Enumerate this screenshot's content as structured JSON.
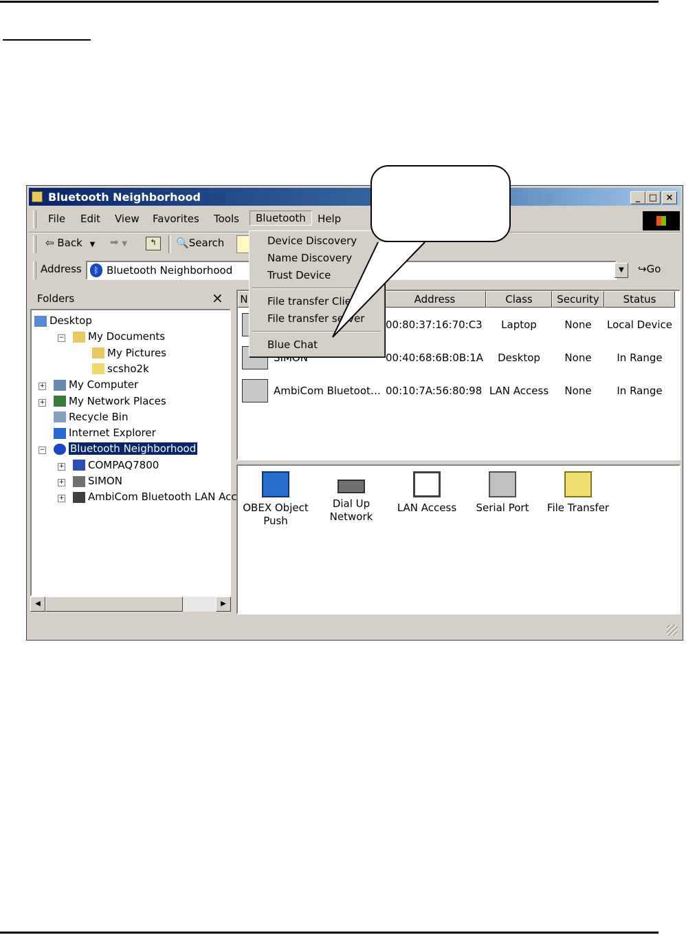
{
  "window": {
    "title": "Bluetooth Neighborhood"
  },
  "menubar": {
    "items": [
      "File",
      "Edit",
      "View",
      "Favorites",
      "Tools",
      "Bluetooth",
      "Help"
    ]
  },
  "toolbar": {
    "back_label": "Back",
    "search_label": "Search"
  },
  "address_bar": {
    "label": "Address",
    "value": "Bluetooth Neighborhood",
    "go_label": "Go"
  },
  "bluetooth_menu": {
    "items": [
      "Device Discovery",
      "Name Discovery",
      "Trust Device",
      "File transfer Client",
      "File transfer server",
      "Blue Chat"
    ]
  },
  "folders": {
    "title": "Folders",
    "close_glyph": "×",
    "tree": [
      {
        "label": "Desktop",
        "icon": "desktop-icon"
      },
      {
        "label": "My Documents",
        "icon": "my-documents-icon",
        "expander": "−"
      },
      {
        "label": "My Pictures",
        "icon": "my-pictures-icon"
      },
      {
        "label": "scsho2k",
        "icon": "folder-icon"
      },
      {
        "label": "My Computer",
        "icon": "my-computer-icon",
        "expander": "+"
      },
      {
        "label": "My Network Places",
        "icon": "network-places-icon",
        "expander": "+"
      },
      {
        "label": "Recycle Bin",
        "icon": "recycle-bin-icon"
      },
      {
        "label": "Internet Explorer",
        "icon": "internet-explorer-icon"
      },
      {
        "label": "Bluetooth Neighborhood",
        "icon": "bluetooth-icon",
        "expander": "−",
        "selected": true
      },
      {
        "label": "COMPAQ7800",
        "icon": "laptop-icon",
        "expander": "+"
      },
      {
        "label": "SIMON",
        "icon": "desktop-computer-icon",
        "expander": "+"
      },
      {
        "label": "AmbiCom Bluetooth LAN Acce",
        "icon": "lan-access-icon",
        "expander": "+"
      }
    ]
  },
  "device_list": {
    "columns": [
      "N",
      "Address",
      "Class",
      "Security",
      "Status"
    ],
    "rows": [
      {
        "name": "",
        "address": "00:80:37:16:70:C3",
        "class": "Laptop",
        "security": "None",
        "status": "Local Device",
        "icon": "laptop-icon"
      },
      {
        "name": "SIMON",
        "address": "00:40:68:6B:0B:1A",
        "class": "Desktop",
        "security": "None",
        "status": "In Range",
        "icon": "desktop-computer-icon"
      },
      {
        "name": "AmbiCom Bluetoot…",
        "address": "00:10:7A:56:80:98",
        "class": "LAN Access",
        "security": "None",
        "status": "In Range",
        "icon": "lan-access-icon"
      }
    ]
  },
  "services": [
    {
      "label": "OBEX Object Push",
      "icon": "obex-push-icon"
    },
    {
      "label": "Dial Up Network",
      "icon": "modem-icon"
    },
    {
      "label": "LAN Access",
      "icon": "lan-access-icon"
    },
    {
      "label": "Serial Port",
      "icon": "serial-port-icon"
    },
    {
      "label": "File Transfer",
      "icon": "file-transfer-icon"
    }
  ],
  "colors": {
    "title_bar": "#0a246a",
    "selection": "#0a246a",
    "window_face": "#d4d0c8"
  }
}
